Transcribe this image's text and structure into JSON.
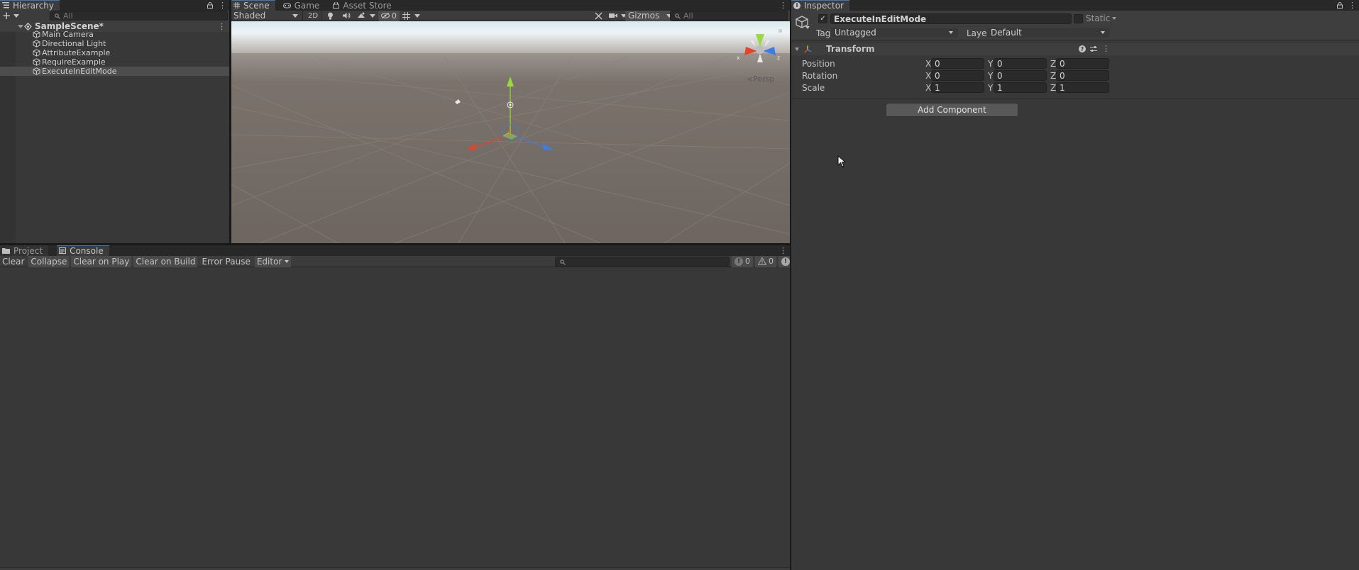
{
  "hierarchy": {
    "tab_label": "Hierarchy",
    "search_placeholder": "All",
    "scene_name": "SampleScene*",
    "items": [
      {
        "label": "Main Camera"
      },
      {
        "label": "Directional Light"
      },
      {
        "label": "AttributeExample"
      },
      {
        "label": "RequireExample"
      },
      {
        "label": "ExecuteInEditMode"
      }
    ],
    "selected_index": 4
  },
  "scene": {
    "tabs": [
      {
        "label": "Scene"
      },
      {
        "label": "Game"
      },
      {
        "label": "Asset Store"
      }
    ],
    "draw_mode": "Shaded",
    "mode_2d": "2D",
    "hidden_count": "0",
    "gizmos_label": "Gizmos",
    "search_placeholder": "All",
    "projection_label": "Persp",
    "axis_x": "x",
    "axis_y": "y",
    "axis_z": "z"
  },
  "console": {
    "tabs": [
      {
        "label": "Project"
      },
      {
        "label": "Console"
      }
    ],
    "buttons": [
      {
        "label": "Clear",
        "active": false
      },
      {
        "label": "Collapse",
        "active": true
      },
      {
        "label": "Clear on Play",
        "active": true
      },
      {
        "label": "Clear on Build",
        "active": true
      },
      {
        "label": "Error Pause",
        "active": false
      }
    ],
    "editor_dropdown": "Editor",
    "log_count": "0",
    "warning_count": "0",
    "error_count": "0"
  },
  "inspector": {
    "tab_label": "Inspector",
    "object_name": "ExecuteInEditMode",
    "static_label": "Static",
    "tag_label": "Tag",
    "tag_value": "Untagged",
    "layer_label": "Layer",
    "layer_value": "Default",
    "component_title": "Transform",
    "rows": [
      {
        "label": "Position",
        "x": "0",
        "y": "0",
        "z": "0"
      },
      {
        "label": "Rotation",
        "x": "0",
        "y": "0",
        "z": "0"
      },
      {
        "label": "Scale",
        "x": "1",
        "y": "1",
        "z": "1"
      }
    ],
    "axis_labels": {
      "x": "X",
      "y": "Y",
      "z": "Z"
    },
    "add_component_label": "Add Component"
  },
  "colors": {
    "accent_blue": "#3a79bb",
    "gizmo_x": "#e6432b",
    "gizmo_y": "#9ad93f",
    "gizmo_z": "#3e7ce8",
    "scene_ground": "#6d655f"
  }
}
